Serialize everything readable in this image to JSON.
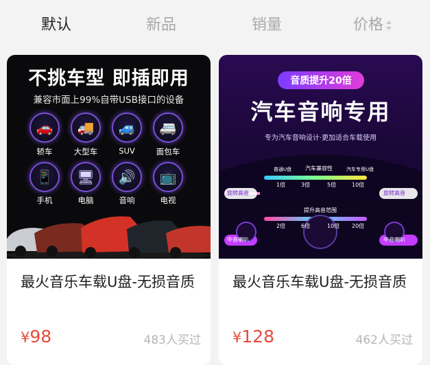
{
  "tabs": [
    {
      "label": "默认",
      "active": true
    },
    {
      "label": "新品",
      "active": false
    },
    {
      "label": "销量",
      "active": false
    },
    {
      "label": "价格",
      "active": false
    }
  ],
  "products": [
    {
      "title": "最火音乐车载U盘-无损音质",
      "currency": "¥",
      "price": "98",
      "sold": "483人买过",
      "image": {
        "headline": "不挑车型  即插即用",
        "subline": "兼容市面上99%自带USB接口的设备",
        "icons": [
          {
            "name": "car-icon",
            "label": "轿车"
          },
          {
            "name": "truck-icon",
            "label": "大型车"
          },
          {
            "name": "suv-icon",
            "label": "SUV"
          },
          {
            "name": "van-icon",
            "label": "面包车"
          },
          {
            "name": "phone-icon",
            "label": "手机"
          },
          {
            "name": "computer-icon",
            "label": "电脑"
          },
          {
            "name": "speaker-icon",
            "label": "音响"
          },
          {
            "name": "tv-icon",
            "label": "电视"
          }
        ]
      }
    },
    {
      "title": "最火音乐车载U盘-无损音质",
      "currency": "¥",
      "price": "128",
      "sold": "462人买过",
      "image": {
        "badge": "音质提升20倍",
        "headline": "汽车音响专用",
        "subline": "专为汽车音响设计·更加适合车载使用",
        "row1_left": "普通U盘",
        "row1_center": "汽车兼容性",
        "row1_right": "汽车专用U盘",
        "row1_ticks": [
          "1倍",
          "3倍",
          "5倍",
          "10倍"
        ],
        "row2_center": "提升高音范围",
        "row2_ticks": [
          "2倍",
          "6倍",
          "10倍",
          "20倍"
        ],
        "tag_left_top": "旋转高音",
        "tag_right_top": "旋转高音",
        "tag_left_bottom": "中音喇叭",
        "tag_right_bottom": "中音喇叭"
      }
    }
  ]
}
